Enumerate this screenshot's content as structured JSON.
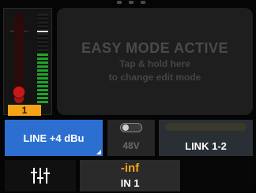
{
  "meter": {
    "channel_number": "1",
    "fader_level": 0.12,
    "meter_level": 0.55,
    "colors": {
      "fader": "#c41a1a",
      "meter": "#1fa32a",
      "channel_badge": "#f5a316"
    }
  },
  "easy_mode": {
    "title": "EASY MODE ACTIVE",
    "line1": "Tap & hold here",
    "line2": "to change edit mode"
  },
  "controls": {
    "line_level_label": "LINE +4 dBu",
    "phantom_label": "48V",
    "phantom_on": false,
    "link_label": "LINK 1-2",
    "accent": "#2c6fd1"
  },
  "footer": {
    "mixer_icon": "mixer-sliders-icon",
    "gain_value": "-inf",
    "channel_name": "IN 1"
  }
}
